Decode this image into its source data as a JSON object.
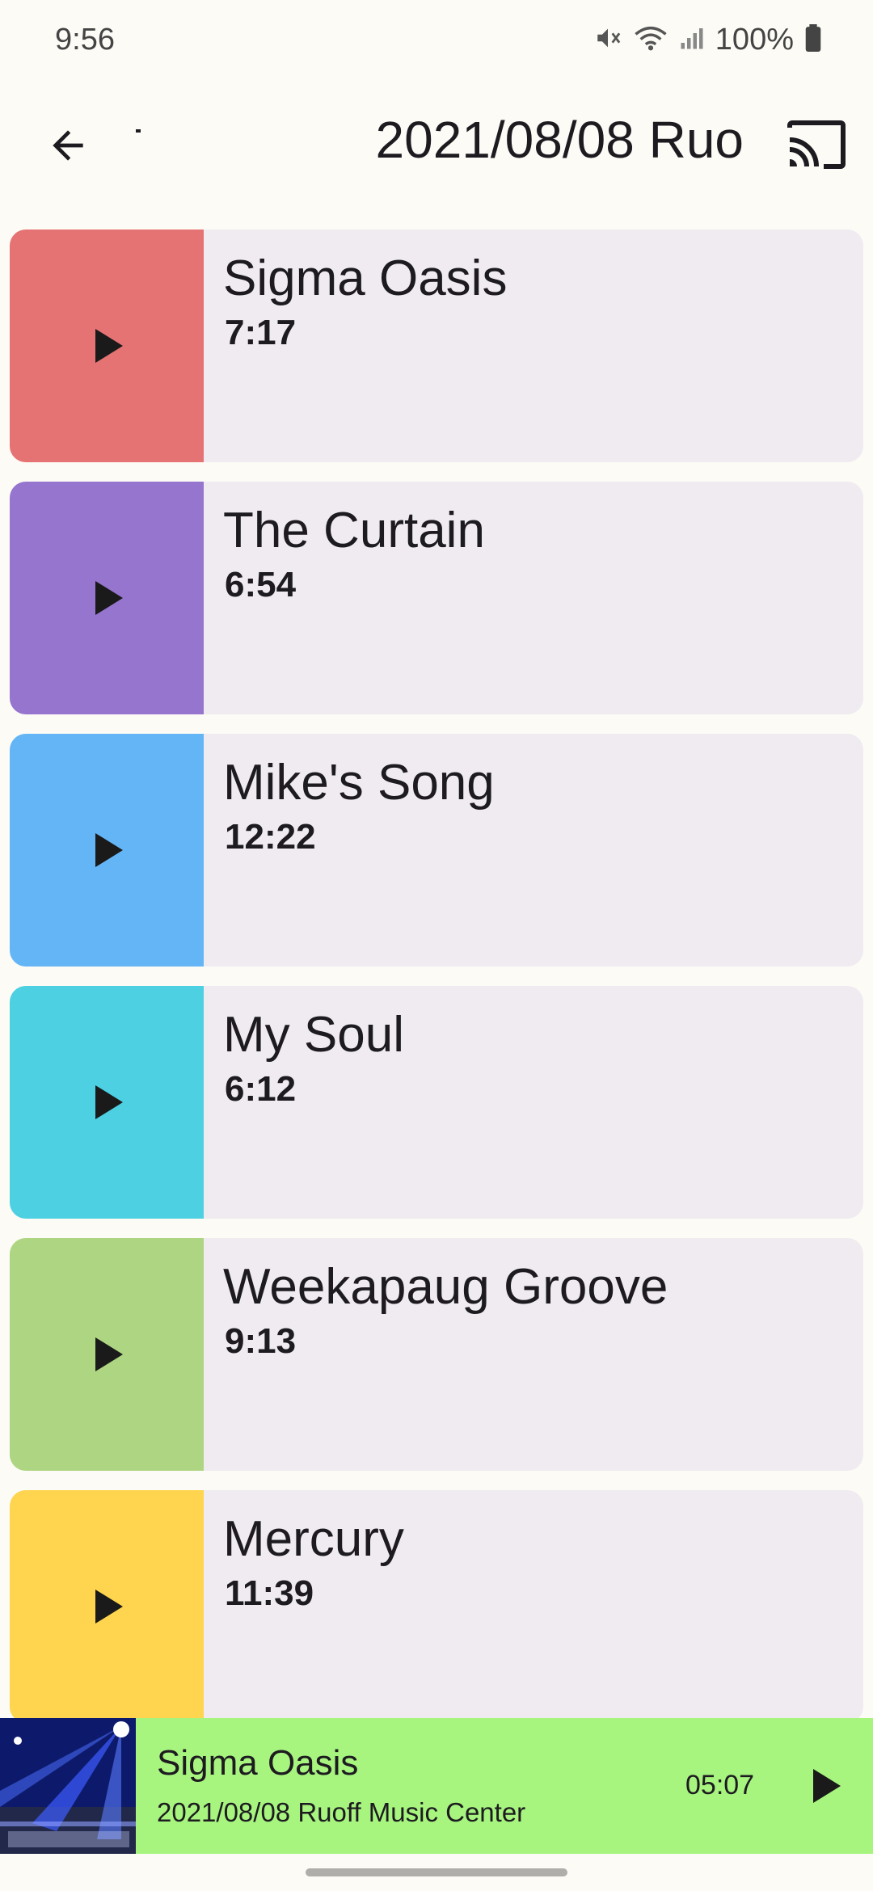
{
  "status_bar": {
    "time": "9:56",
    "battery_text": "100%",
    "icons": [
      "mute-icon",
      "wifi-icon",
      "signal-icon",
      "battery-icon"
    ]
  },
  "app_bar": {
    "title": "2021/08/08 Ruo",
    "back_icon": "arrow-left-icon",
    "cast_icon": "cast-icon"
  },
  "tracks": [
    {
      "title": "Sigma Oasis",
      "duration": "7:17",
      "color": "#e57373"
    },
    {
      "title": "The Curtain",
      "duration": "6:54",
      "color": "#9575cd"
    },
    {
      "title": "Mike's Song",
      "duration": "12:22",
      "color": "#64b5f6"
    },
    {
      "title": "My Soul",
      "duration": "6:12",
      "color": "#4dd0e1"
    },
    {
      "title": "Weekapaug Groove",
      "duration": "9:13",
      "color": "#aed581"
    },
    {
      "title": "Mercury",
      "duration": "11:39",
      "color": "#ffd54f"
    }
  ],
  "now_playing": {
    "title": "Sigma Oasis",
    "subtitle": "2021/08/08 Ruoff Music Center",
    "time": "05:07",
    "background": "#a7f57f"
  }
}
